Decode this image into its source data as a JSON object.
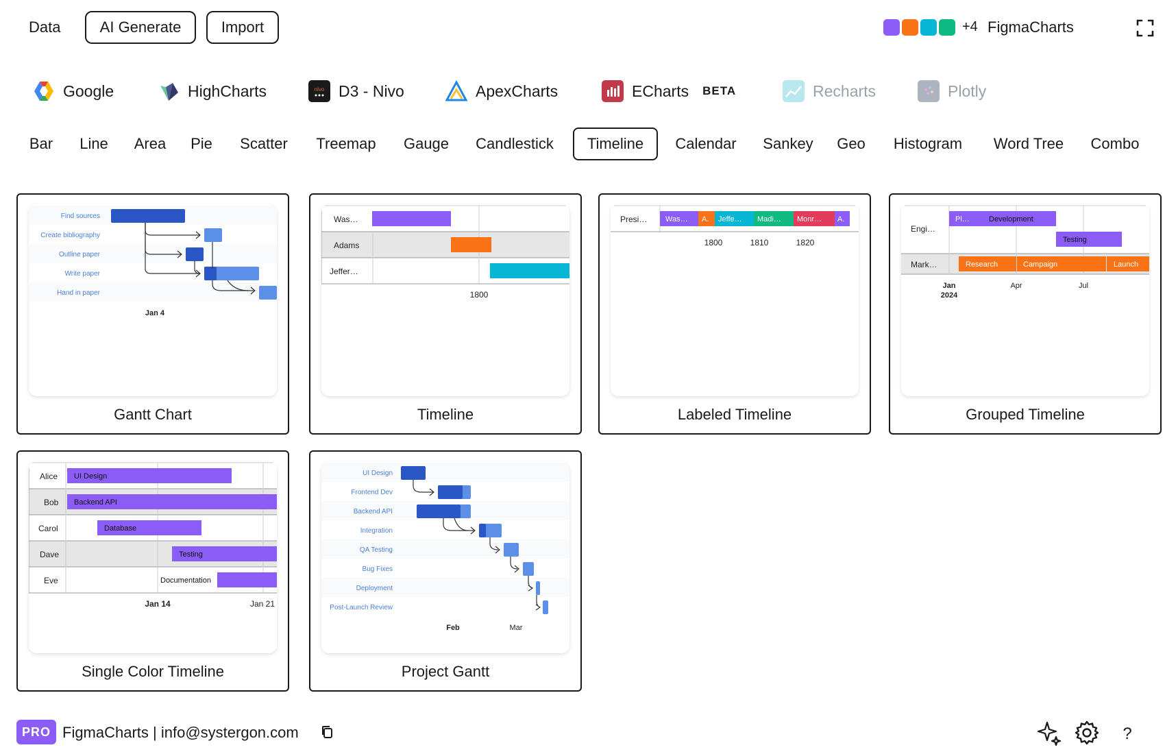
{
  "topbar": {
    "data_label": "Data",
    "ai_generate_label": "AI Generate",
    "import_label": "Import",
    "swatch_colors": [
      "#8b5cf6",
      "#f97316",
      "#06b6d4",
      "#10b981"
    ],
    "more_colors_label": "+4",
    "brand": "FigmaCharts"
  },
  "libraries": [
    {
      "name": "Google",
      "icon": "google-icon",
      "enabled": true
    },
    {
      "name": "HighCharts",
      "icon": "highcharts-icon",
      "enabled": true
    },
    {
      "name": "D3 - Nivo",
      "icon": "nivo-icon",
      "enabled": true
    },
    {
      "name": "ApexCharts",
      "icon": "apexcharts-icon",
      "enabled": true
    },
    {
      "name": "ECharts",
      "icon": "echarts-icon",
      "enabled": true,
      "badge": "BETA"
    },
    {
      "name": "Recharts",
      "icon": "recharts-icon",
      "enabled": false
    },
    {
      "name": "Plotly",
      "icon": "plotly-icon",
      "enabled": false
    }
  ],
  "chart_types": [
    "Bar",
    "Line",
    "Area",
    "Pie",
    "Scatter",
    "Treemap",
    "Gauge",
    "Candlestick",
    "Timeline",
    "Calendar",
    "Sankey",
    "Geo",
    "Histogram",
    "Word Tree",
    "Combo"
  ],
  "active_chart_type": "Timeline",
  "cards": {
    "gantt": {
      "title": "Gantt Chart",
      "tasks": [
        "Find sources",
        "Create bibliography",
        "Outline paper",
        "Write paper",
        "Hand in paper"
      ],
      "axis": "Jan 4"
    },
    "timeline": {
      "title": "Timeline",
      "rows": [
        "Was…",
        "Adams",
        "Jeffer…"
      ],
      "axis": "1800"
    },
    "labeled": {
      "title": "Labeled Timeline",
      "row": "Presi…",
      "bars": [
        "Was…",
        "A.",
        "Jeffe…",
        "Madi…",
        "Monr…",
        "A."
      ],
      "axis": [
        "1800",
        "1810",
        "1820"
      ]
    },
    "grouped": {
      "title": "Grouped Timeline",
      "rows": [
        "Engi…",
        "Mark…"
      ],
      "bars": [
        "Pl…",
        "Development",
        "Testing",
        "Research",
        "Campaign",
        "Launch"
      ],
      "axis": [
        "Jan",
        "2024",
        "Apr",
        "Jul"
      ]
    },
    "single": {
      "title": "Single Color Timeline",
      "rows": [
        "Alice",
        "Bob",
        "Carol",
        "Dave",
        "Eve"
      ],
      "bars": [
        "UI Design",
        "Backend API",
        "Database",
        "Testing",
        "Documentation"
      ],
      "axis": [
        "Jan 14",
        "Jan 21"
      ]
    },
    "project": {
      "title": "Project Gantt",
      "tasks": [
        "UI Design",
        "Frontend Dev",
        "Backend API",
        "Integration",
        "QA Testing",
        "Bug Fixes",
        "Deployment",
        "Post-Launch Review"
      ],
      "axis": [
        "Feb",
        "Mar"
      ]
    }
  },
  "footer": {
    "pro_badge": "PRO",
    "text": "FigmaCharts | info@systergon.com"
  }
}
